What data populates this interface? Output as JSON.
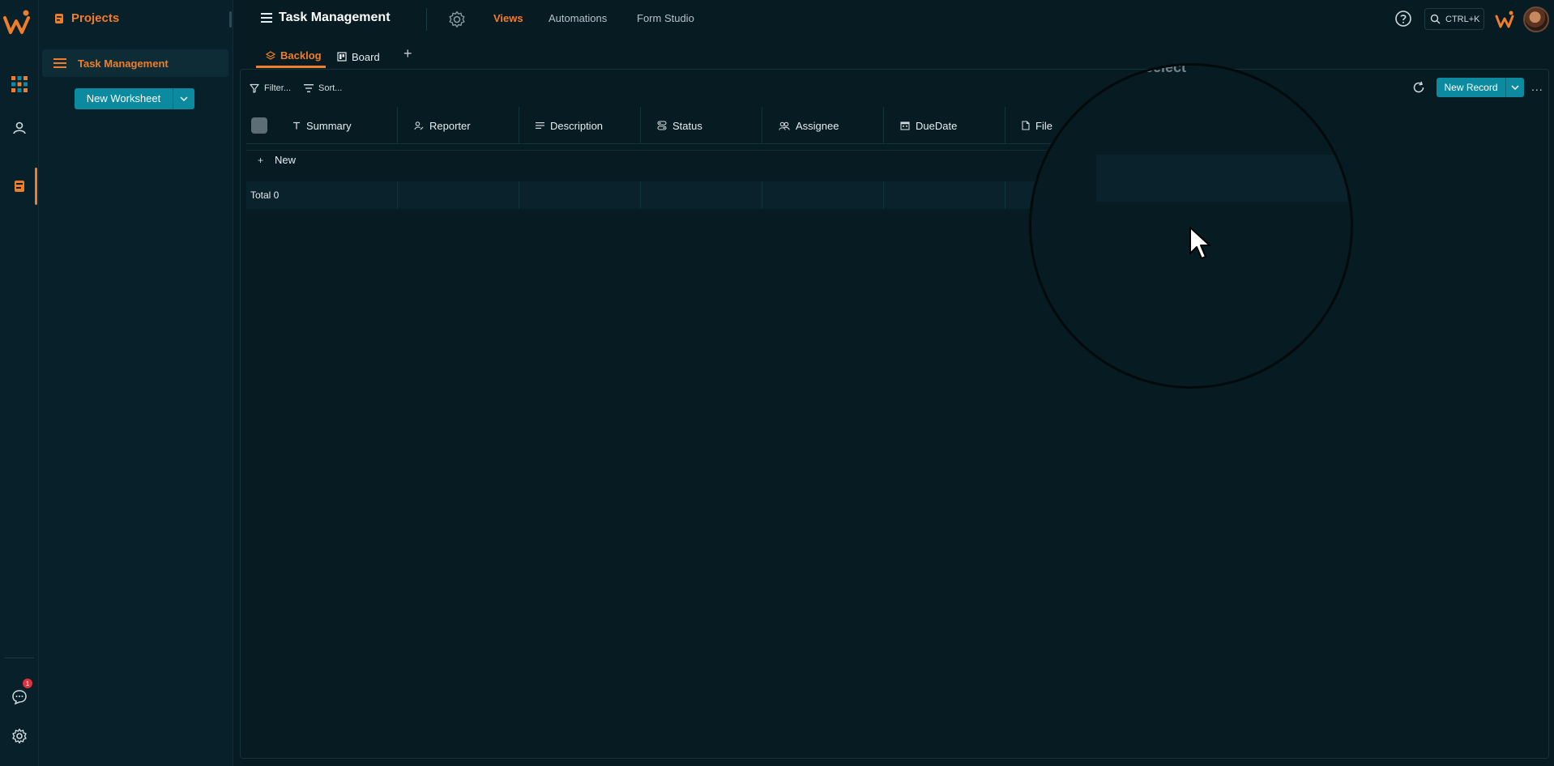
{
  "app": {
    "title": "Task Management",
    "nav": {
      "views": "Views",
      "automations": "Automations",
      "form_studio": "Form Studio"
    },
    "search_shortcut": "CTRL+K",
    "accent_color": "#f07d2a",
    "primary_button_color": "#0b8aa0"
  },
  "sidebar": {
    "section_title": "Projects",
    "items": [
      {
        "label": "Task Management",
        "icon": "list-icon"
      }
    ],
    "new_worksheet_label": "New Worksheet"
  },
  "rail": {
    "icons": [
      "logo-icon",
      "apps-grid-icon",
      "user-icon",
      "project-icon",
      "chat-icon",
      "gear-icon"
    ],
    "notification_count": "1"
  },
  "views": {
    "tabs": [
      {
        "label": "Backlog",
        "icon": "layers-icon"
      },
      {
        "label": "Board",
        "icon": "board-icon"
      }
    ],
    "add_label": "+"
  },
  "toolbar": {
    "filter_label": "Filter...",
    "sort_label": "Sort...",
    "new_record_label": "New Record",
    "more_label": "..."
  },
  "table": {
    "columns": [
      {
        "label": "Summary",
        "icon": "text-icon"
      },
      {
        "label": "Reporter",
        "icon": "person-edit-icon"
      },
      {
        "label": "Description",
        "icon": "align-left-icon"
      },
      {
        "label": "Status",
        "icon": "toggle-icon"
      },
      {
        "label": "Assignee",
        "icon": "people-icon"
      },
      {
        "label": "DueDate",
        "icon": "calendar-icon"
      },
      {
        "label": "File",
        "icon": "file-icon"
      }
    ],
    "new_row_label": "New",
    "total_label": "Total 0"
  },
  "magnifier": {
    "label": "select"
  }
}
